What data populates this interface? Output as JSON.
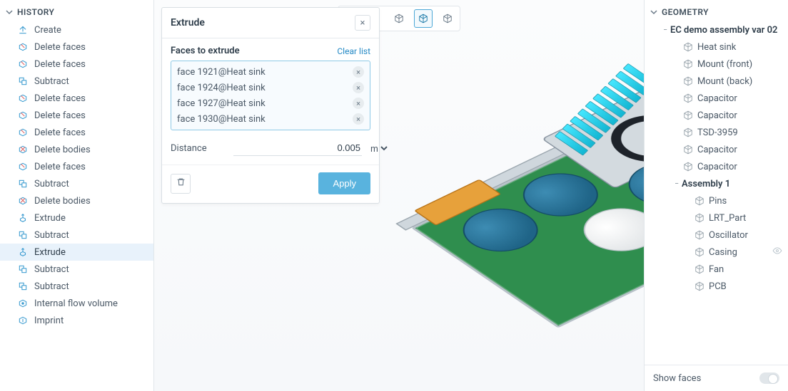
{
  "history": {
    "title": "HISTORY",
    "items": [
      {
        "icon": "create-icon",
        "label": "Create"
      },
      {
        "icon": "delete-faces-icon",
        "label": "Delete faces"
      },
      {
        "icon": "delete-faces-icon",
        "label": "Delete faces"
      },
      {
        "icon": "subtract-icon",
        "label": "Subtract"
      },
      {
        "icon": "delete-faces-icon",
        "label": "Delete faces"
      },
      {
        "icon": "delete-faces-icon",
        "label": "Delete faces"
      },
      {
        "icon": "delete-faces-icon",
        "label": "Delete faces"
      },
      {
        "icon": "delete-bodies-icon",
        "label": "Delete bodies"
      },
      {
        "icon": "delete-faces-icon",
        "label": "Delete faces"
      },
      {
        "icon": "subtract-icon",
        "label": "Subtract"
      },
      {
        "icon": "delete-bodies-icon",
        "label": "Delete bodies"
      },
      {
        "icon": "extrude-icon",
        "label": "Extrude"
      },
      {
        "icon": "subtract-icon",
        "label": "Subtract"
      },
      {
        "icon": "extrude-icon",
        "label": "Extrude",
        "selected": true
      },
      {
        "icon": "subtract-icon",
        "label": "Subtract"
      },
      {
        "icon": "subtract-icon",
        "label": "Subtract"
      },
      {
        "icon": "flow-volume-icon",
        "label": "Internal flow volume"
      },
      {
        "icon": "imprint-icon",
        "label": "Imprint"
      }
    ]
  },
  "dialog": {
    "title": "Extrude",
    "faces_label": "Faces to extrude",
    "clear_label": "Clear list",
    "faces": [
      "face 1921@Heat sink",
      "face 1924@Heat sink",
      "face 1927@Heat sink",
      "face 1930@Heat sink"
    ],
    "distance_label": "Distance",
    "distance_value": "0.005",
    "distance_unit": "m",
    "apply_label": "Apply"
  },
  "view_modes": {
    "buttons": [
      "wire",
      "shaded",
      "shaded-edges",
      "transparent",
      "points"
    ],
    "active_index": 3
  },
  "geometry": {
    "title": "GEOMETRY",
    "root": "EC demo assembly var 02",
    "nodes": [
      {
        "label": "Heat sink"
      },
      {
        "label": "Mount (front)"
      },
      {
        "label": "Mount (back)"
      },
      {
        "label": "Capacitor"
      },
      {
        "label": "Capacitor"
      },
      {
        "label": "TSD-3959"
      },
      {
        "label": "Capacitor"
      },
      {
        "label": "Capacitor"
      }
    ],
    "assembly1_label": "Assembly 1",
    "assembly1_nodes": [
      {
        "label": "Pins"
      },
      {
        "label": "LRT_Part"
      },
      {
        "label": "Oscillator"
      },
      {
        "label": "Casing",
        "eye": true
      },
      {
        "label": "Fan"
      },
      {
        "label": "PCB"
      }
    ],
    "show_faces_label": "Show faces",
    "show_faces_on": false
  },
  "icons": {
    "chevron_down": "⌄",
    "close": "×",
    "remove": "×",
    "trash": "🗑",
    "eye": "👁"
  },
  "colors": {
    "accent": "#59b3de",
    "link": "#2489c5",
    "select_bg": "#e8f2fb"
  }
}
